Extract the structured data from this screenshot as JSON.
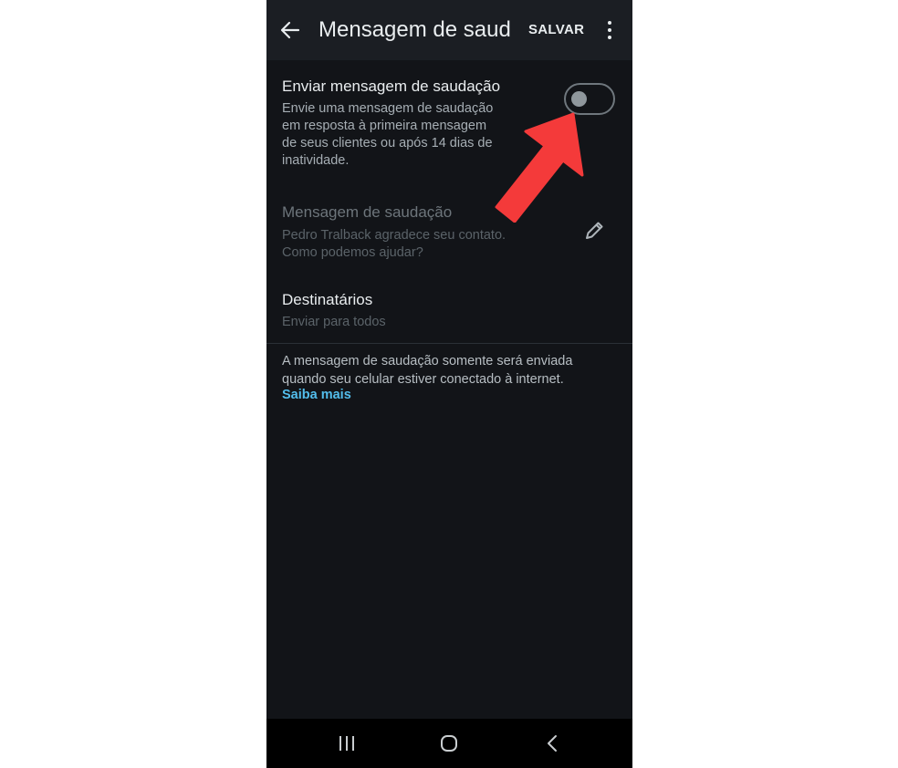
{
  "header": {
    "title": "Mensagem de sauda...",
    "save_label": "SALVAR",
    "back_icon": "arrow-left-icon",
    "more_icon": "more-vertical-icon"
  },
  "greeting_toggle": {
    "title": "Enviar mensagem de saudação",
    "description_lines": [
      "Envie uma mensagem de saudação",
      "em resposta à primeira mensagem",
      "de seus clientes ou após 14 dias de",
      "inatividade."
    ],
    "enabled": false
  },
  "greeting_message": {
    "title": "Mensagem de saudação",
    "text_lines": [
      "Pedro Tralback agradece seu contato.",
      "Como podemos ajudar?"
    ],
    "edit_icon": "pencil-icon"
  },
  "recipients": {
    "title": "Destinatários",
    "value": "Enviar para todos"
  },
  "info": {
    "lines": [
      "A mensagem de saudação somente será enviada",
      "quando seu celular estiver conectado à internet."
    ],
    "learn_more": "Saiba mais"
  },
  "system_nav": {
    "recents_icon": "recents-icon",
    "home_icon": "home-icon",
    "back_icon": "back-chevron-icon"
  },
  "colors": {
    "background": "#121418",
    "appbar": "#1b1e23",
    "link": "#53bdeb",
    "annotation_arrow": "#f43a3a"
  }
}
